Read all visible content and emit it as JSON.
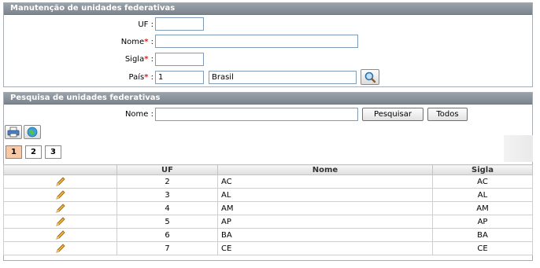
{
  "maint": {
    "title": "Manutenção de unidades federativas",
    "uf_label": "UF",
    "nome_label": "Nome",
    "sigla_label": "Sigla",
    "pais_label": "País",
    "required_mark": "*",
    "colon": ":",
    "uf_value": "",
    "nome_value": "",
    "sigla_value": "",
    "pais_code": "1",
    "pais_name": "Brasil"
  },
  "search": {
    "title": "Pesquisa de unidades federativas",
    "nome_label": "Nome",
    "colon": ":",
    "nome_value": "",
    "pesquisar_label": "Pesquisar",
    "todos_label": "Todos"
  },
  "pagination": [
    "1",
    "2",
    "3"
  ],
  "table": {
    "columns": [
      "",
      "UF",
      "Nome",
      "Sigla"
    ],
    "rows": [
      {
        "uf": "2",
        "nome": "AC",
        "sigla": "AC"
      },
      {
        "uf": "3",
        "nome": "AL",
        "sigla": "AL"
      },
      {
        "uf": "4",
        "nome": "AM",
        "sigla": "AM"
      },
      {
        "uf": "5",
        "nome": "AP",
        "sigla": "AP"
      },
      {
        "uf": "6",
        "nome": "BA",
        "sigla": "BA"
      },
      {
        "uf": "7",
        "nome": "CE",
        "sigla": "CE"
      }
    ]
  },
  "icons": {
    "lookup": "magnifier-icon",
    "print": "printer-icon",
    "globe": "globe-icon",
    "edit": "pencil-icon"
  }
}
